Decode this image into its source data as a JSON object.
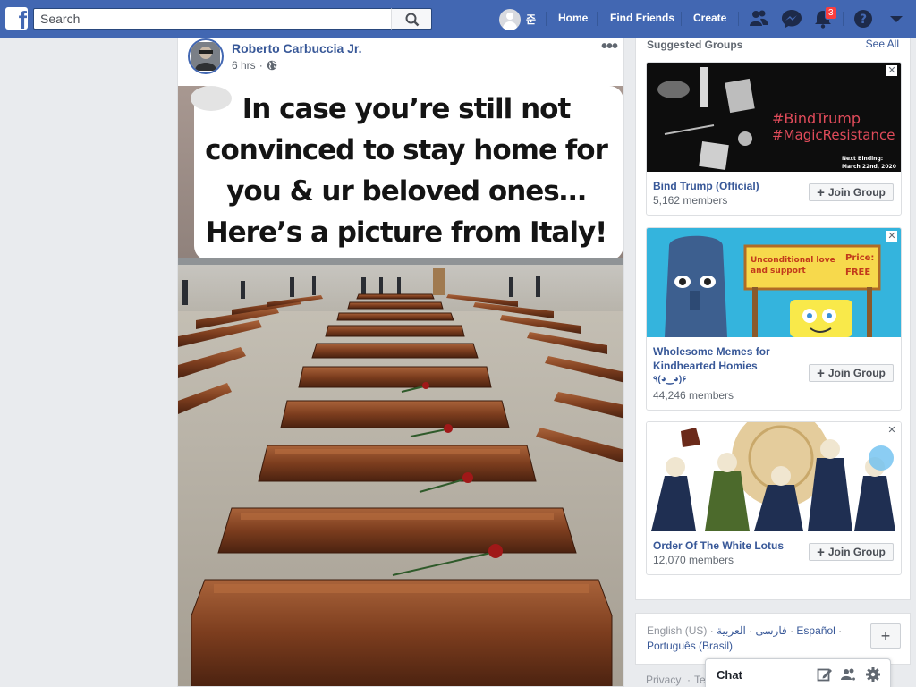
{
  "topbar": {
    "logo_letter": "f",
    "search_placeholder": "Search",
    "profile_name": "준",
    "nav": [
      "Home",
      "Find Friends",
      "Create"
    ],
    "notifications_count": "3",
    "colors": {
      "bar": "#4267b2",
      "badge": "#fa3e3e"
    },
    "icons": [
      "friend-requests-icon",
      "messenger-icon",
      "notifications-icon",
      "help-icon",
      "account-menu-icon"
    ]
  },
  "post": {
    "author": "Roberto Carbuccia Jr.",
    "time": "6 hrs",
    "privacy_icon": "globe-icon",
    "more_label": "•••",
    "image_caption": [
      "In case you’re still not",
      "convinced to stay home for",
      "you & ur beloved ones…",
      "Here’s a picture from Italy!"
    ]
  },
  "suggested_groups": {
    "title": "Suggested Groups",
    "see_all": "See All",
    "join_label": "Join Group",
    "groups": [
      {
        "name": "Bind Trump (Official)",
        "members": "5,162 members",
        "image_lines": [
          "#BindTrump",
          "#MagicResistance"
        ],
        "image_small": [
          "Next Binding:",
          "March 22nd, 2020"
        ]
      },
      {
        "name": "Wholesome Memes for Kindhearted Homies",
        "name_line1": "Wholesome Memes for",
        "name_line2": "Kindhearted Homies",
        "name_line3": "٩(◕‿◕)۶",
        "members": "44,246 members",
        "image_sign": [
          "Unconditional love",
          "and support"
        ],
        "image_price": [
          "Price:",
          "FREE"
        ]
      },
      {
        "name": "Order Of The White Lotus",
        "members": "12,070 members"
      }
    ]
  },
  "languages": {
    "current": "English (US)",
    "others": [
      "فارسی",
      "العربية",
      "Español",
      "Português (Brasil)"
    ],
    "add_label": "+"
  },
  "footer": {
    "privacy": "Privacy",
    "terms": "Te"
  },
  "chat": {
    "title": "Chat"
  }
}
